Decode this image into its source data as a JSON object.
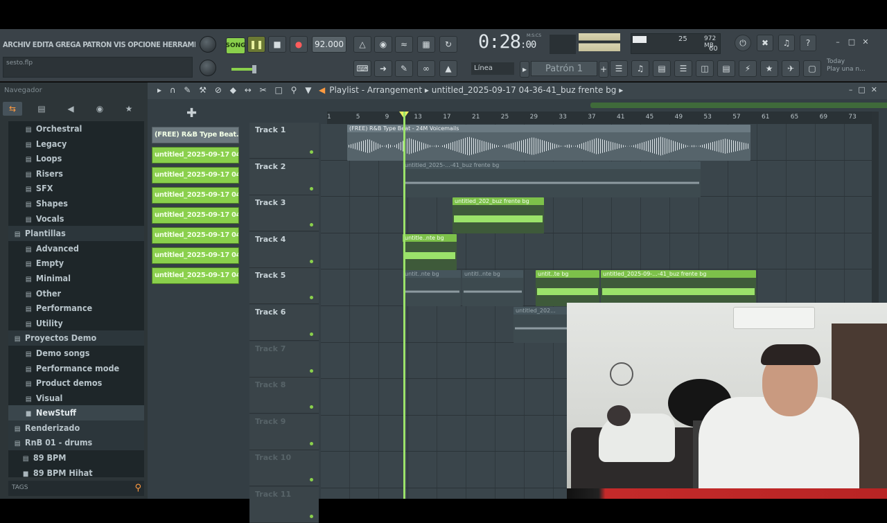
{
  "menu": [
    "ARCHIV",
    "EDITA",
    "GREGA",
    "PATRON",
    "VIS",
    "OPCIONE",
    "HERRAMIENTA"
  ],
  "hint": "sesto.flp",
  "transport": {
    "pat_label": "SONG",
    "play_icon": "pause-icon",
    "stop_icon": "stop-icon",
    "rec_icon": "record-icon",
    "tempo": "92.000"
  },
  "time": {
    "main": "0:28",
    "sub": ":00",
    "unit": "M:S:CS"
  },
  "cpu": {
    "value": "25",
    "mem": "972 MB",
    "poly": "60"
  },
  "snap": "Línea",
  "pattern": "Patrón 1",
  "news": {
    "line1": "Today",
    "line2": "Play una n..."
  },
  "browser": {
    "header": "Navegador",
    "tabs": [
      "all-icon",
      "doc-icon",
      "share-icon",
      "plugin-icon",
      "star-icon"
    ],
    "items": [
      {
        "label": "Orchestral",
        "type": "folder"
      },
      {
        "label": "Legacy",
        "type": "folder"
      },
      {
        "label": "Loops",
        "type": "folder"
      },
      {
        "label": "Risers",
        "type": "folder"
      },
      {
        "label": "SFX",
        "type": "folder"
      },
      {
        "label": "Shapes",
        "type": "folder"
      },
      {
        "label": "Vocals",
        "type": "folder"
      },
      {
        "label": "Plantillas",
        "type": "section"
      },
      {
        "label": "Advanced",
        "type": "folder"
      },
      {
        "label": "Empty",
        "type": "folder"
      },
      {
        "label": "Minimal",
        "type": "folder"
      },
      {
        "label": "Other",
        "type": "folder"
      },
      {
        "label": "Performance",
        "type": "folder"
      },
      {
        "label": "Utility",
        "type": "folder"
      },
      {
        "label": "Proyectos Demo",
        "type": "section"
      },
      {
        "label": "Demo songs",
        "type": "folder"
      },
      {
        "label": "Performance mode",
        "type": "folder"
      },
      {
        "label": "Product demos",
        "type": "folder"
      },
      {
        "label": "Visual",
        "type": "folder"
      },
      {
        "label": "NewStuff",
        "type": "file"
      },
      {
        "label": "Renderizado",
        "type": "section"
      },
      {
        "label": "RnB 01 - drums",
        "type": "section"
      },
      {
        "label": "89 BPM",
        "type": "folder"
      },
      {
        "label": "89 BPM Hihat",
        "type": "file"
      }
    ],
    "tags_label": "TAGS"
  },
  "playlist": {
    "title_prefix": "Playlist - Arrangement",
    "title_name": "untitled_2025-09-17 04-36-41_buz frente bg",
    "picker": [
      "(FREE) R&B Type Beat..",
      "untitled_2025-09-17 04-..",
      "untitled_2025-09-17 04-..",
      "untitled_2025-09-17 04-..",
      "untitled_2025-09-17 04-..",
      "untitled_2025-09-17 04-..",
      "untitled_2025-09-17 04-..",
      "untitled_2025-09-17 04-.."
    ],
    "ruler": [
      "1",
      "5",
      "9",
      "13",
      "17",
      "21",
      "25",
      "29",
      "33",
      "37",
      "41",
      "45",
      "49",
      "53",
      "57",
      "61",
      "65",
      "69",
      "73"
    ],
    "tracks": [
      "Track 1",
      "Track 2",
      "Track 3",
      "Track 4",
      "Track 5",
      "Track 6",
      "Track 7",
      "Track 8",
      "Track 9",
      "Track 10",
      "Track 11"
    ],
    "clips": {
      "t1": "(FREE) R&B Type Beat - 24M Voicemails",
      "t2": "untitled_2025-...-41_buz frente bg",
      "t3": "untitled_202_buz frente bg",
      "t4": "untitle..nte bg",
      "t5a": "untit..nte bg",
      "t5b": "untitl..nte bg",
      "t5c": "untit..te bg",
      "t5d": "untitled_2025-09-...-41_buz frente bg",
      "t6": "untitled_202..."
    }
  }
}
